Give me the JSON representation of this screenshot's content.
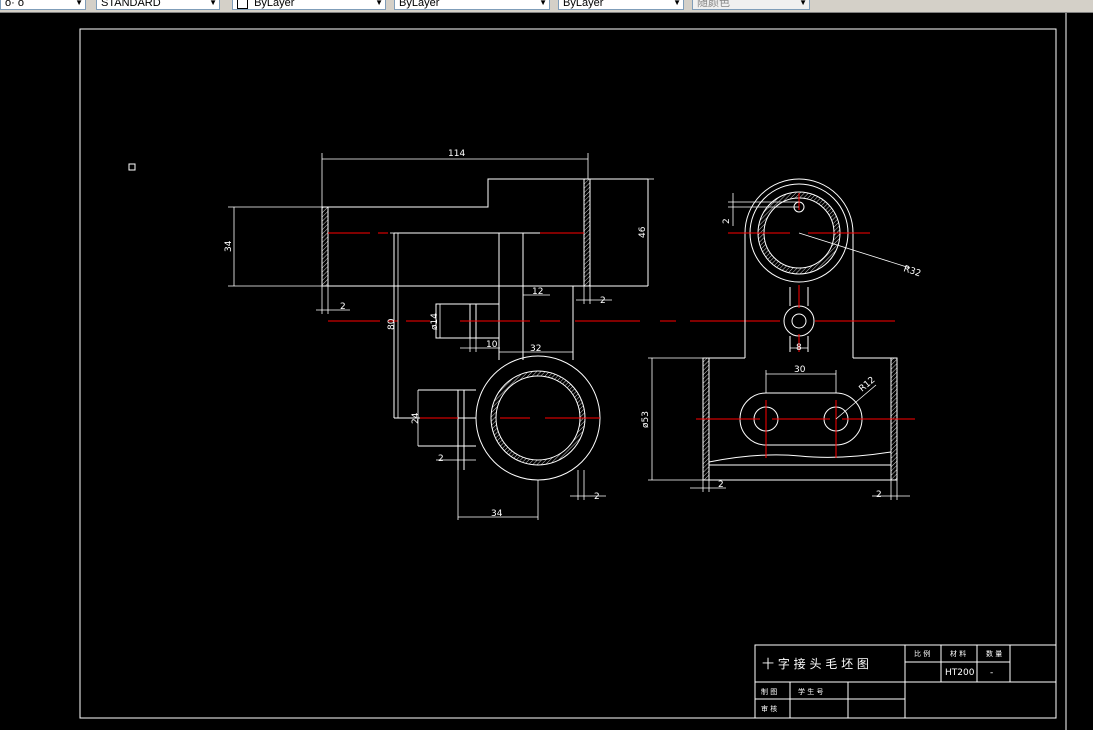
{
  "toolbar": {
    "combo_first": "o· o",
    "combo_style": "STANDARD",
    "combo_color": "ByLayer",
    "combo_linetype": "ByLayer",
    "combo_lineweight": "ByLayer",
    "combo_plotstyle": "随颜色"
  },
  "dimensions": {
    "d114": "114",
    "d34_left": "34",
    "d46": "46",
    "d2_a": "2",
    "d2_b": "2",
    "d12": "12",
    "d80": "80",
    "d14": "ø14",
    "d10": "10",
    "d32": "32",
    "d24": "24",
    "d2_c": "2",
    "d2_d": "2",
    "d34_bottom": "34",
    "r32": "R32",
    "d2_top": "2",
    "d8": "8",
    "d30": "30",
    "r12": "R12",
    "d53": "ø53",
    "d2_e": "2",
    "d2_f": "2"
  },
  "title_block": {
    "drawing_title": "十 字 接 头 毛 坯 图",
    "header_ratio": "比 例",
    "header_material": "材 料",
    "header_qty": "数 量",
    "material_value": "HT200",
    "qty_value": "-",
    "row_design": "制 图",
    "row_student_id": "学 生 号",
    "row_review": "审 核"
  },
  "colors": {
    "background": "#000000",
    "lines": "#ffffff",
    "center_lines": "#ff0000",
    "toolbar": "#d4d0c8"
  }
}
